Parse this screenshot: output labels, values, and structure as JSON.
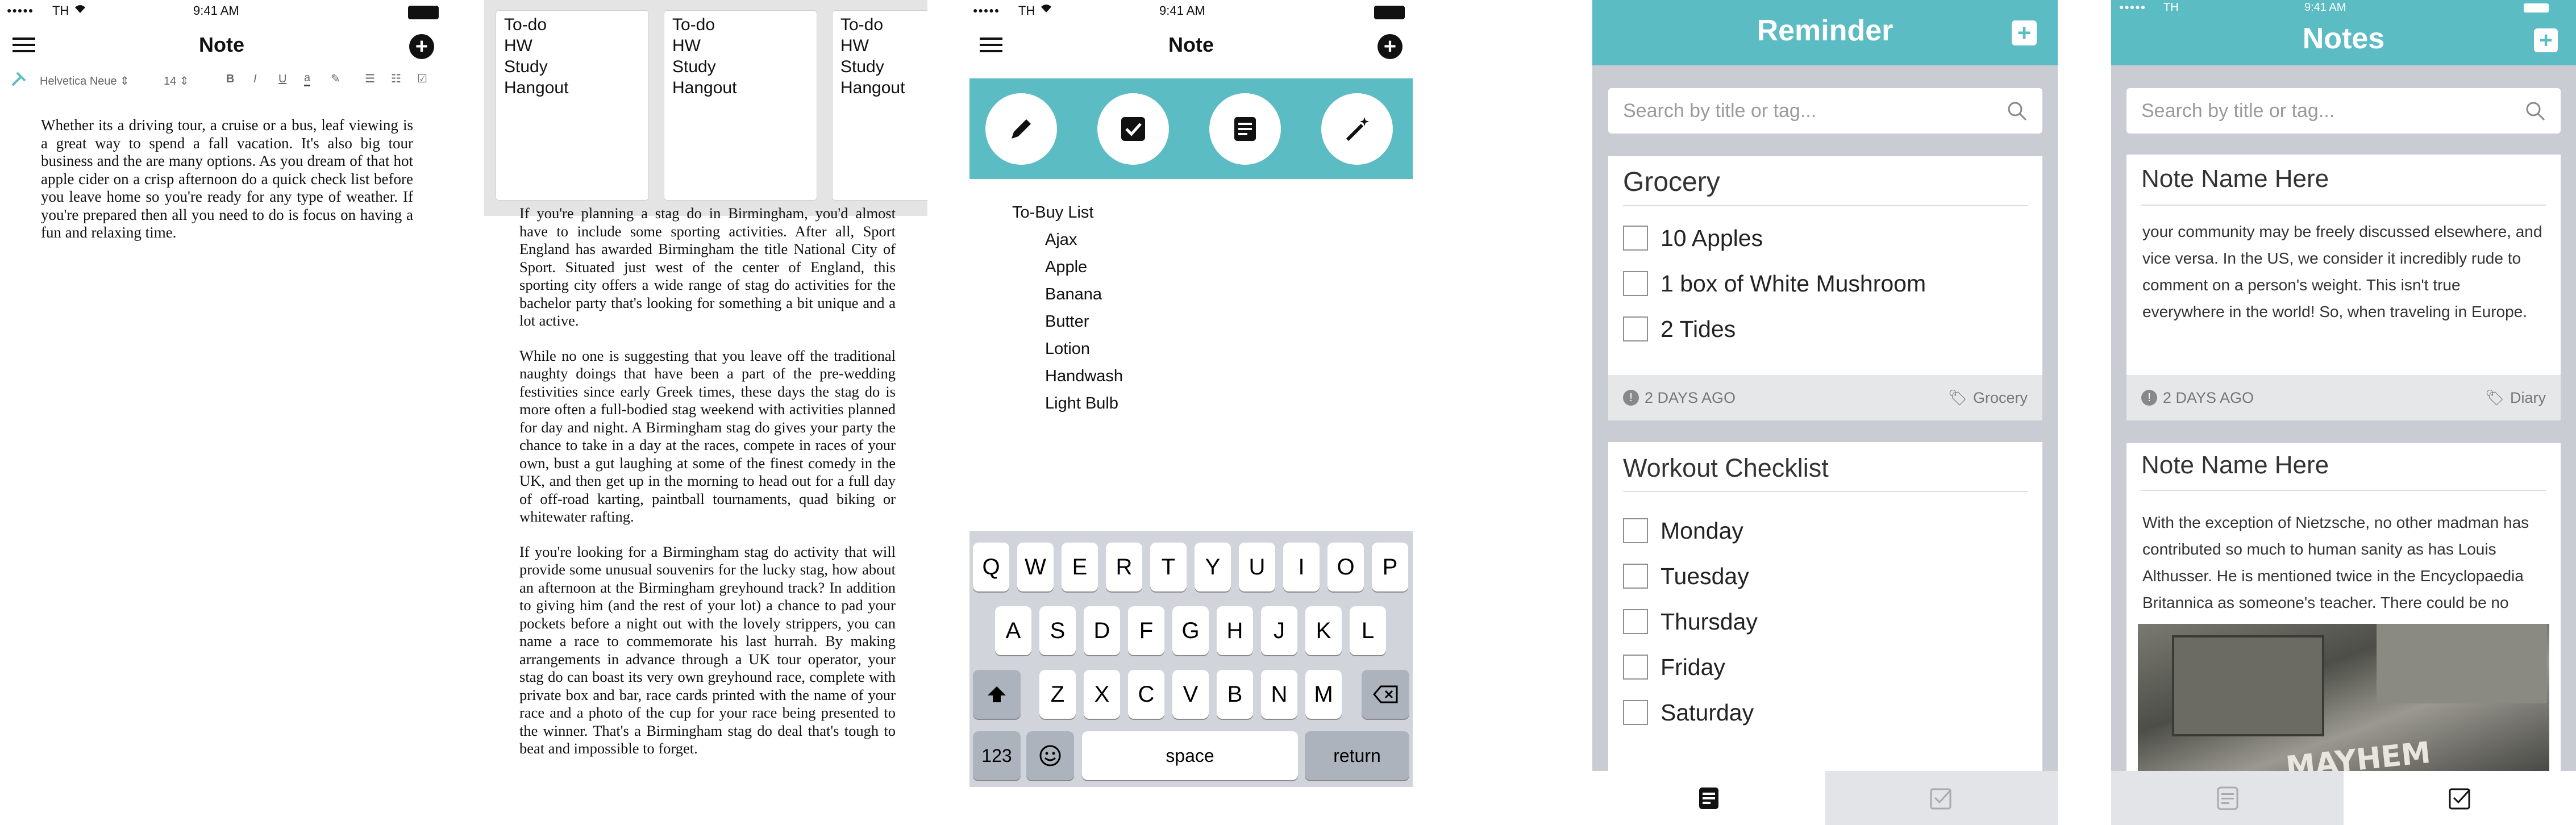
{
  "status": {
    "carrier": "TH",
    "time": "9:41 AM"
  },
  "panel1": {
    "title": "Note",
    "font_name": "Helvetica Neue",
    "font_size": "14",
    "body": "Whether its a driving tour, a cruise or a bus, leaf viewing is a great way to spend a fall vacation. It's also big tour business and the are many options. As you dream of that hot apple cider on a crisp afternoon do a quick check list before you leave home so you're ready for any type of weather. If you're prepared then all you need to do is focus on having a fun and relaxing time."
  },
  "panel2": {
    "cards": [
      [
        "To-do",
        "HW",
        "Study",
        "Hangout"
      ],
      [
        "To-do",
        "HW",
        "Study",
        "Hangout"
      ],
      [
        "To-do",
        "HW",
        "Study",
        "Hangout"
      ]
    ],
    "paragraphs": [
      "If you're planning a stag do in Birmingham, you'd almost have to include some sporting activities. After all, Sport England has awarded Birmingham the title National City of Sport. Situated just west of the center of England, this sporting city offers a wide range of stag do activities for the bachelor party that's looking for something a bit unique and a lot active.",
      "While no one is suggesting that you leave off the traditional naughty doings that have been a part of the pre-wedding festivities since early Greek times, these days the stag do is more often a full-bodied stag weekend with activities planned for day and night. A Birmingham stag do gives your party the chance to take in a day at the races, compete in races of your own, bust a gut laughing at some of the finest comedy in the UK, and then get up in the morning to head out for a full day of off-road karting, paintball tournaments, quad biking or whitewater rafting.",
      "If you're looking for a Birmingham stag do activity that will provide some unusual souvenirs for the lucky stag, how about an afternoon at the Birmingham greyhound track? In addition to giving him (and the rest of your lot) a chance to pad your pockets before a night out with the lovely strippers, you can name a race to commemorate his last hurrah. By making arrangements in advance through a UK tour operator, your stag do can boast its very own greyhound race, complete with private box and bar, race cards printed with the name of your race and a photo of the cup for your race being presented to the winner. That's a Birmingham stag do deal that's tough to beat and impossible to forget."
    ]
  },
  "panel3": {
    "title": "Note",
    "list_title": "To-Buy List",
    "items": [
      "Ajax",
      "Apple",
      "Banana",
      "Butter",
      "Lotion",
      "Handwash",
      "Light Bulb"
    ],
    "keyboard": {
      "row1": [
        "Q",
        "W",
        "E",
        "R",
        "T",
        "Y",
        "U",
        "I",
        "O",
        "P"
      ],
      "row2": [
        "A",
        "S",
        "D",
        "F",
        "G",
        "H",
        "J",
        "K",
        "L"
      ],
      "row3": [
        "Z",
        "X",
        "C",
        "V",
        "B",
        "N",
        "M"
      ],
      "numbers": "123",
      "space": "space",
      "return": "return"
    }
  },
  "panel4": {
    "title": "Reminder",
    "search_placeholder": "Search by title or tag...",
    "card1": {
      "title": "Grocery",
      "items": [
        "10 Apples",
        "1 box of  White Mushroom",
        "2 Tides"
      ],
      "time": "2 DAYS AGO",
      "tag": "Grocery"
    },
    "card2": {
      "title": "Workout Checklist",
      "items": [
        "Monday",
        "Tuesday",
        "Thursday",
        "Friday",
        "Saturday"
      ]
    }
  },
  "panel5": {
    "title": "Notes",
    "search_placeholder": "Search by title or tag...",
    "card1": {
      "title": "Note Name Here",
      "text": "your community may be freely discussed elsewhere, and vice versa. In the US, we consider it incredibly rude to comment on a person's weight. This isn't true everywhere in the world! So, when traveling in Europe.",
      "time": "2 DAYS AGO",
      "tag": "Diary"
    },
    "card2": {
      "title": "Note Name Here",
      "text": "With the exception of Nietzsche, no other madman has contributed so much to human sanity as has Louis Althusser. He is mentioned twice in the Encyclopaedia Britannica as someone's teacher. There could be no",
      "graffiti": "MAYHEM"
    }
  },
  "colors": {
    "teal": "#5bbcc4",
    "card_bg": "#c9ccd3"
  }
}
